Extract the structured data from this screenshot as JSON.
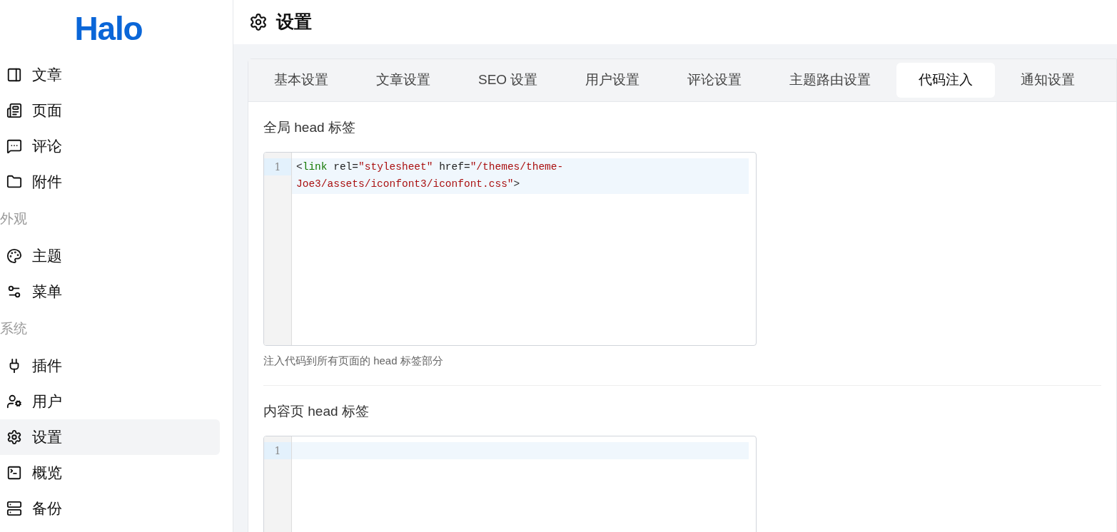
{
  "sidebar": {
    "logo": "Halo",
    "sections": [
      {
        "items": [
          {
            "label": "文章",
            "selected": false
          },
          {
            "label": "页面",
            "selected": false
          },
          {
            "label": "评论",
            "selected": false
          },
          {
            "label": "附件",
            "selected": false
          }
        ]
      },
      {
        "title": "外观",
        "items": [
          {
            "label": "主题",
            "selected": false
          },
          {
            "label": "菜单",
            "selected": false
          }
        ]
      },
      {
        "title": "系统",
        "items": [
          {
            "label": "插件",
            "selected": false
          },
          {
            "label": "用户",
            "selected": false
          },
          {
            "label": "设置",
            "selected": true
          },
          {
            "label": "概览",
            "selected": false
          },
          {
            "label": "备份",
            "selected": false
          }
        ]
      }
    ]
  },
  "header": {
    "title": "设置"
  },
  "tabs": [
    {
      "label": "基本设置",
      "selected": false
    },
    {
      "label": "文章设置",
      "selected": false
    },
    {
      "label": "SEO 设置",
      "selected": false
    },
    {
      "label": "用户设置",
      "selected": false
    },
    {
      "label": "评论设置",
      "selected": false
    },
    {
      "label": "主题路由设置",
      "selected": false
    },
    {
      "label": "代码注入",
      "selected": true
    },
    {
      "label": "通知设置",
      "selected": false
    }
  ],
  "fields": [
    {
      "label": "全局 head 标签",
      "line_number": "1",
      "code": [
        {
          "kind": "punct",
          "text": "<"
        },
        {
          "kind": "tag",
          "text": "link"
        },
        {
          "kind": "attr",
          "text": " rel="
        },
        {
          "kind": "string",
          "text": "\"stylesheet\""
        },
        {
          "kind": "attr",
          "text": " href="
        },
        {
          "kind": "string",
          "text": "\"/themes/theme-Joe3/assets/iconfont3/iconfont.css\""
        },
        {
          "kind": "punct",
          "text": ">"
        }
      ],
      "help": "注入代码到所有页面的 head 标签部分"
    },
    {
      "label": "内容页 head 标签",
      "line_number": "1"
    }
  ]
}
